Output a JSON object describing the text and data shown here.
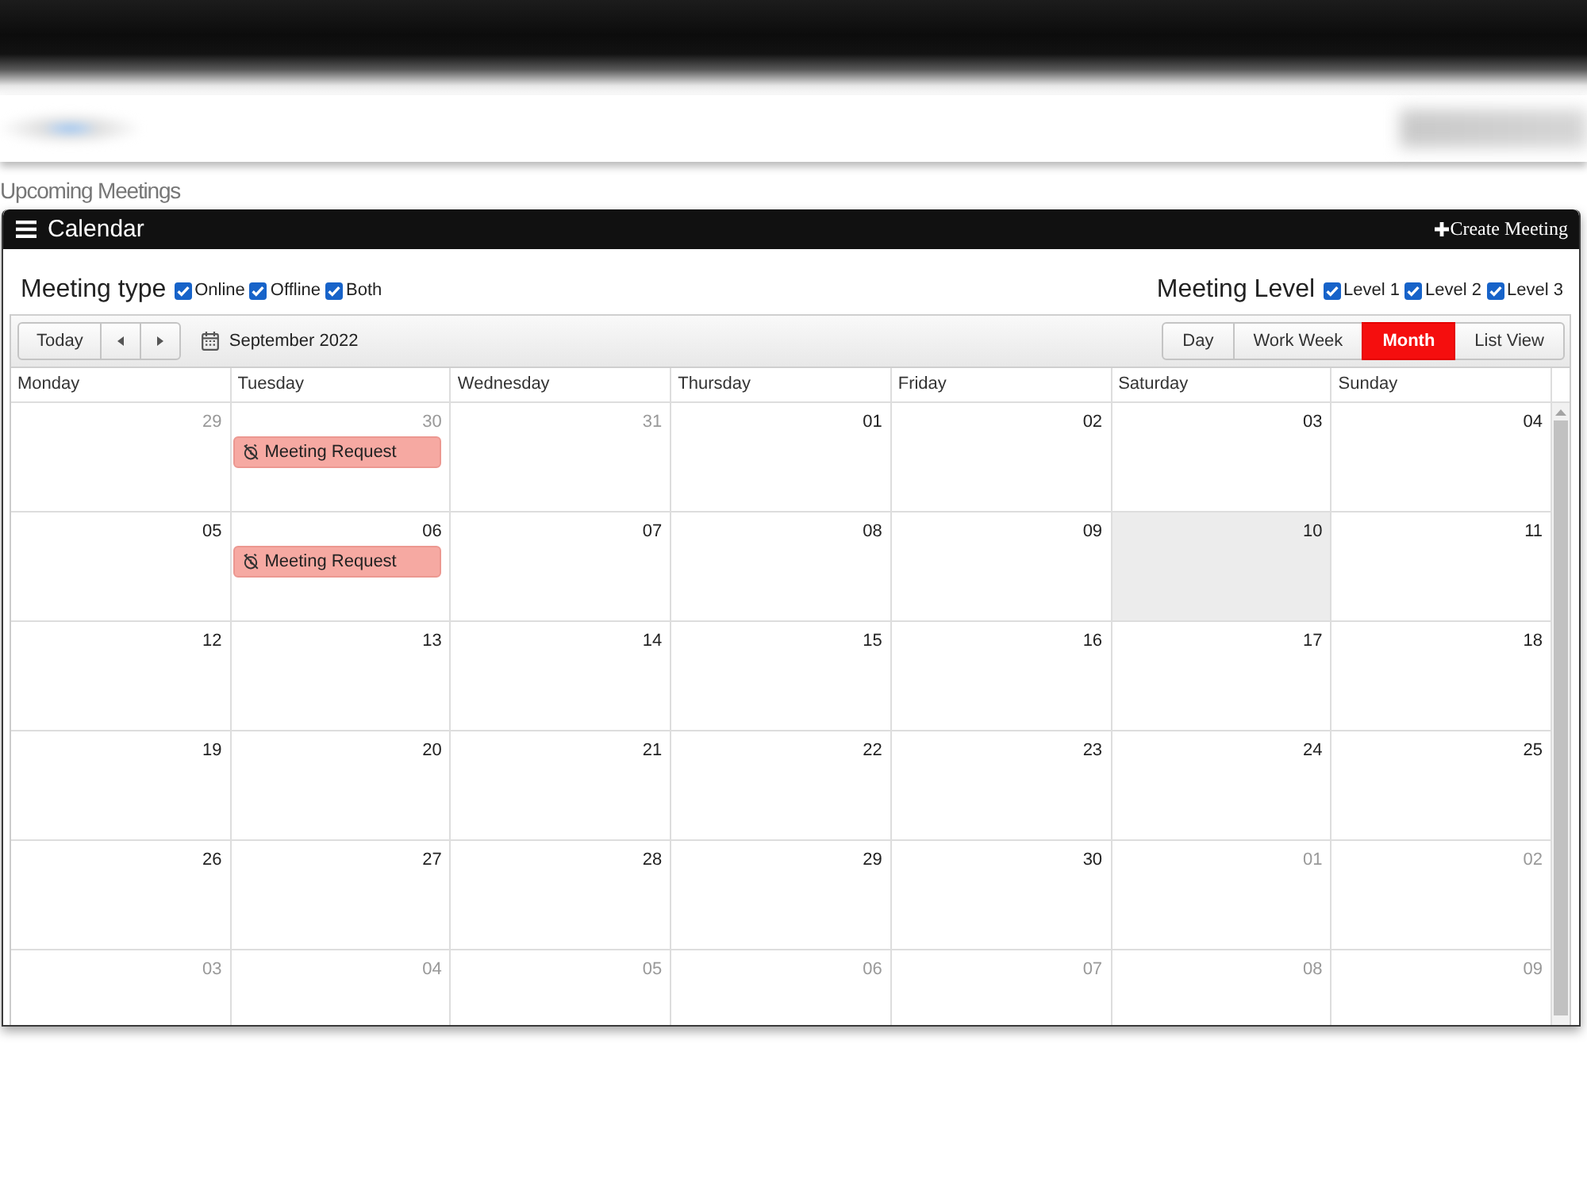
{
  "page": {
    "section_title": "Upcoming Meetings"
  },
  "panel": {
    "title": "Calendar",
    "action": "Create Meeting"
  },
  "filters": [
    {
      "label": "Meeting type",
      "options": [
        {
          "label": "Online",
          "checked": true
        },
        {
          "label": "Offline",
          "checked": true
        },
        {
          "label": "Both",
          "checked": true
        }
      ]
    },
    {
      "label": "Meeting Level",
      "options": [
        {
          "label": "Level 1",
          "checked": true
        },
        {
          "label": "Level 2",
          "checked": true
        },
        {
          "label": "Level 3",
          "checked": true
        }
      ]
    }
  ],
  "toolbar": {
    "today_button": "Today",
    "period": "September 2022",
    "views": [
      {
        "label": "Day",
        "selected": false
      },
      {
        "label": "Work Week",
        "selected": false
      },
      {
        "label": "Month",
        "selected": true
      },
      {
        "label": "List View",
        "selected": false
      }
    ]
  },
  "weekdays": [
    "Monday",
    "Tuesday",
    "Wednesday",
    "Thursday",
    "Friday",
    "Saturday",
    "Sunday"
  ],
  "weeks": [
    {
      "days": [
        {
          "date": "29",
          "other_month": true,
          "today": false
        },
        {
          "date": "30",
          "other_month": true,
          "today": false,
          "events": [
            {
              "title": "Meeting Request"
            }
          ]
        },
        {
          "date": "31",
          "other_month": true,
          "today": false
        },
        {
          "date": "01",
          "other_month": false,
          "today": false
        },
        {
          "date": "02",
          "other_month": false,
          "today": false
        },
        {
          "date": "03",
          "other_month": false,
          "today": false
        },
        {
          "date": "04",
          "other_month": false,
          "today": false
        }
      ]
    },
    {
      "days": [
        {
          "date": "05",
          "other_month": false,
          "today": false
        },
        {
          "date": "06",
          "other_month": false,
          "today": false,
          "events": [
            {
              "title": "Meeting Request"
            }
          ]
        },
        {
          "date": "07",
          "other_month": false,
          "today": false
        },
        {
          "date": "08",
          "other_month": false,
          "today": false
        },
        {
          "date": "09",
          "other_month": false,
          "today": false
        },
        {
          "date": "10",
          "other_month": false,
          "today": true
        },
        {
          "date": "11",
          "other_month": false,
          "today": false
        }
      ]
    },
    {
      "days": [
        {
          "date": "12",
          "other_month": false,
          "today": false
        },
        {
          "date": "13",
          "other_month": false,
          "today": false
        },
        {
          "date": "14",
          "other_month": false,
          "today": false
        },
        {
          "date": "15",
          "other_month": false,
          "today": false
        },
        {
          "date": "16",
          "other_month": false,
          "today": false
        },
        {
          "date": "17",
          "other_month": false,
          "today": false
        },
        {
          "date": "18",
          "other_month": false,
          "today": false
        }
      ]
    },
    {
      "days": [
        {
          "date": "19",
          "other_month": false,
          "today": false
        },
        {
          "date": "20",
          "other_month": false,
          "today": false
        },
        {
          "date": "21",
          "other_month": false,
          "today": false
        },
        {
          "date": "22",
          "other_month": false,
          "today": false
        },
        {
          "date": "23",
          "other_month": false,
          "today": false
        },
        {
          "date": "24",
          "other_month": false,
          "today": false
        },
        {
          "date": "25",
          "other_month": false,
          "today": false
        }
      ]
    },
    {
      "days": [
        {
          "date": "26",
          "other_month": false,
          "today": false
        },
        {
          "date": "27",
          "other_month": false,
          "today": false
        },
        {
          "date": "28",
          "other_month": false,
          "today": false
        },
        {
          "date": "29",
          "other_month": false,
          "today": false
        },
        {
          "date": "30",
          "other_month": false,
          "today": false
        },
        {
          "date": "01",
          "other_month": true,
          "today": false
        },
        {
          "date": "02",
          "other_month": true,
          "today": false
        }
      ]
    },
    {
      "days": [
        {
          "date": "03",
          "other_month": true,
          "today": false
        },
        {
          "date": "04",
          "other_month": true,
          "today": false
        },
        {
          "date": "05",
          "other_month": true,
          "today": false
        },
        {
          "date": "06",
          "other_month": true,
          "today": false
        },
        {
          "date": "07",
          "other_month": true,
          "today": false
        },
        {
          "date": "08",
          "other_month": true,
          "today": false
        },
        {
          "date": "09",
          "other_month": true,
          "today": false
        }
      ]
    }
  ]
}
